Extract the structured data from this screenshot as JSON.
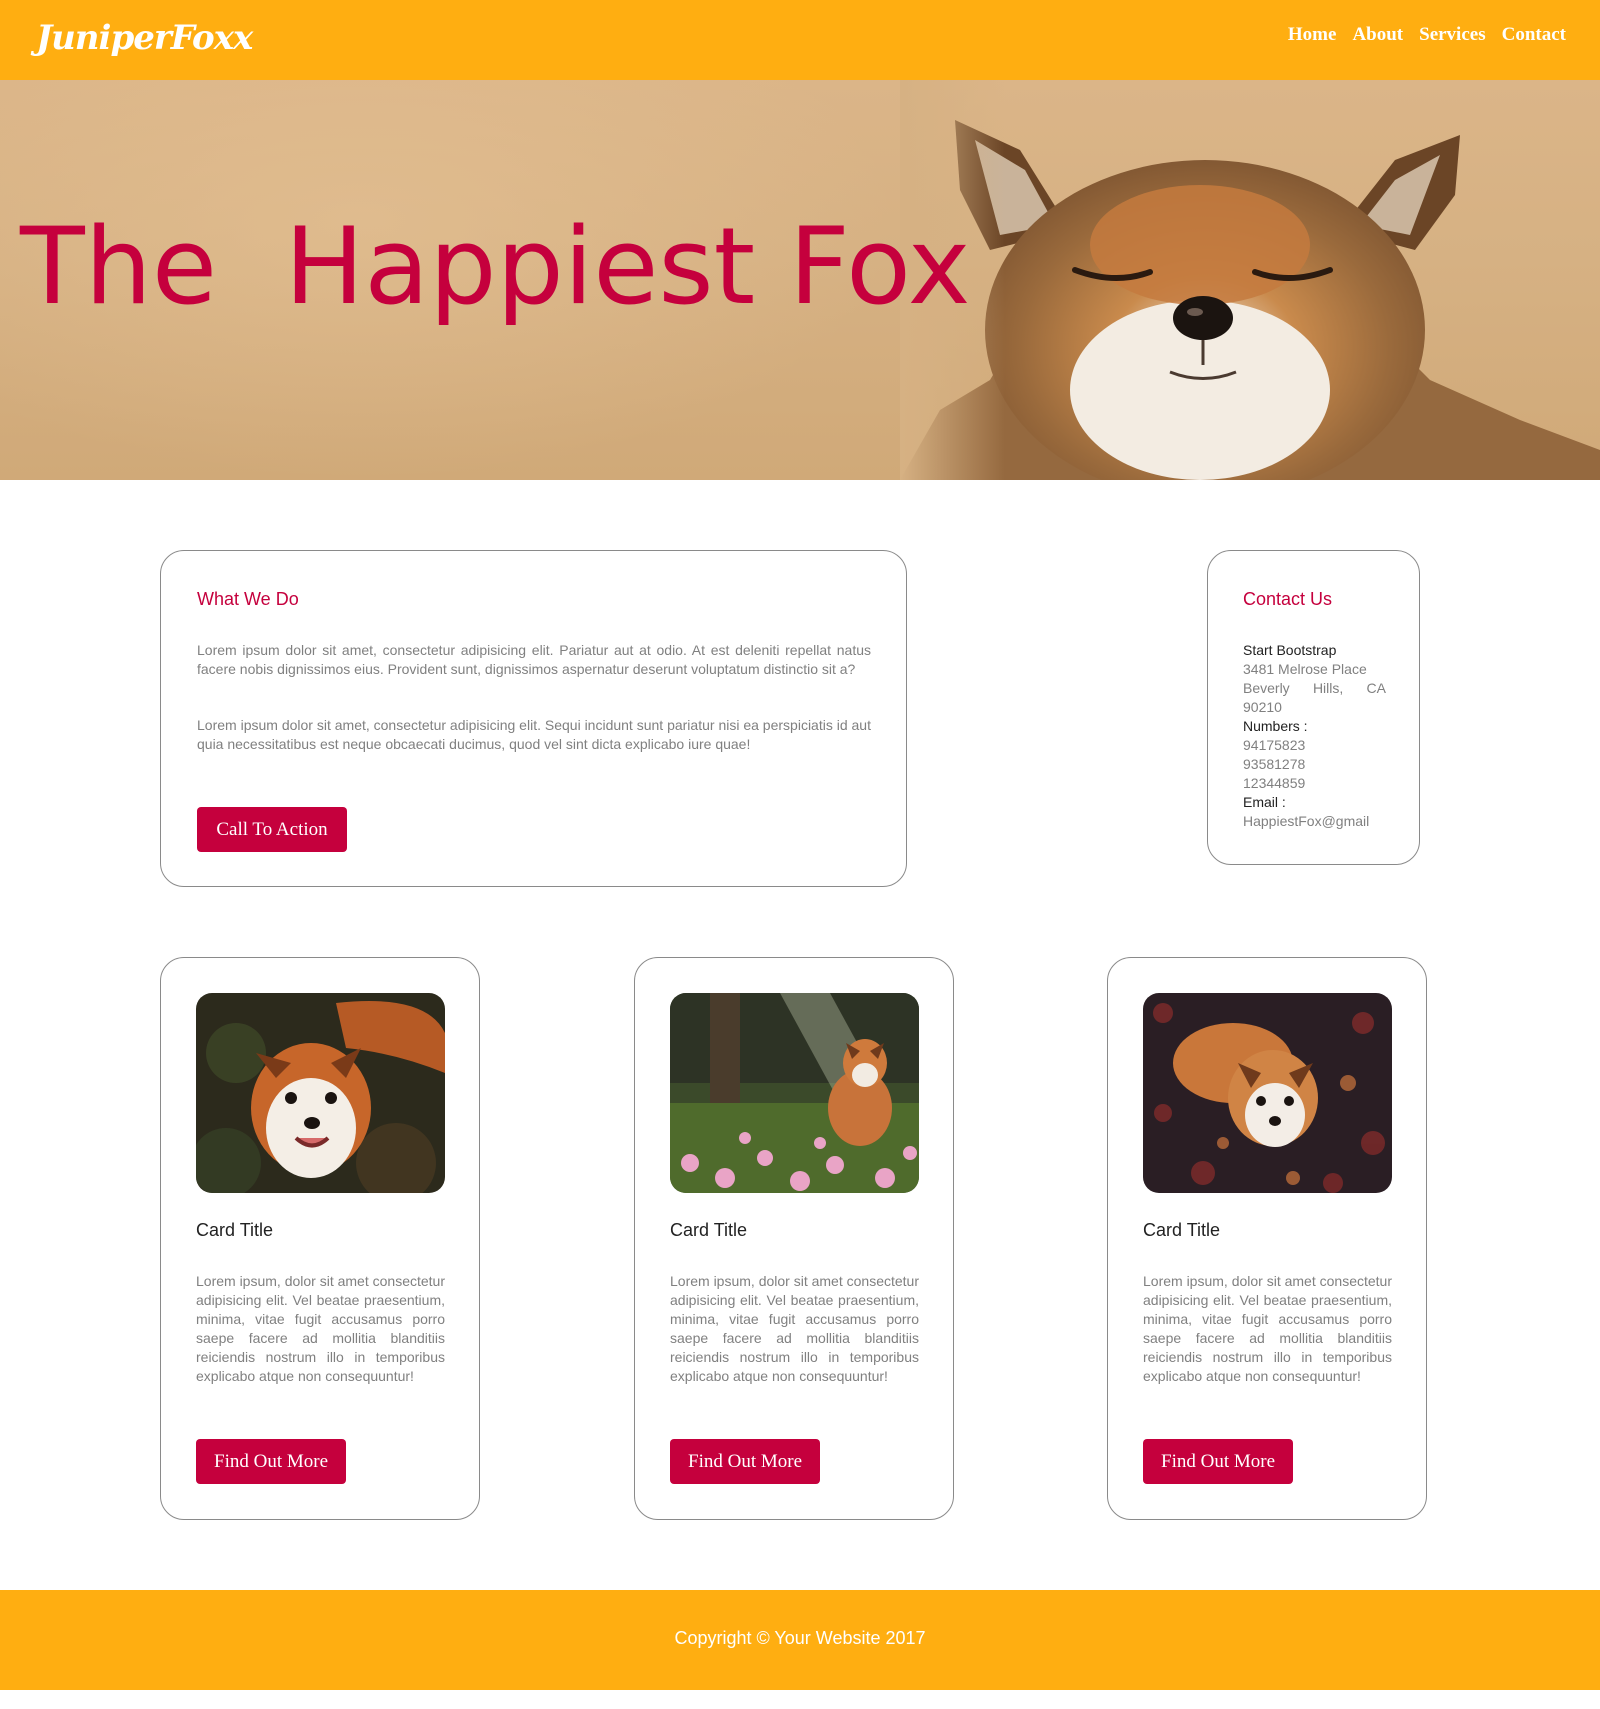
{
  "nav": {
    "brand": "JuniperFoxx",
    "links": [
      "Home",
      "About",
      "Services",
      "Contact"
    ]
  },
  "hero": {
    "title": "The  Happiest Fox",
    "image": "smiling-fox-photo"
  },
  "what_we_do": {
    "heading": "What We Do",
    "paragraph1": "Lorem ipsum dolor sit amet, consectetur adipisicing elit. Pariatur aut at odio. At est deleniti repellat natus facere nobis dignissimos eius. Provident sunt, dignissimos aspernatur deserunt voluptatum distinctio sit a?",
    "paragraph2": "Lorem ipsum dolor sit amet, consectetur adipisicing elit. Sequi incidunt sunt pariatur nisi ea perspiciatis id aut quia necessitatibus est neque obcaecati ducimus, quod vel sint dicta explicabo iure quae!",
    "button": "Call To Action"
  },
  "contact": {
    "heading": "Contact Us",
    "name": "Start Bootstrap",
    "address_line1": "3481 Melrose Place",
    "address_line2": "Beverly Hills, CA",
    "address_line3": "90210",
    "numbers_label": "Numbers :",
    "numbers": [
      "94175823",
      "93581278",
      "12344859"
    ],
    "email_label": "Email :",
    "email": "HappiestFox@gmail"
  },
  "cards": [
    {
      "title": "Card Title",
      "text": "Lorem ipsum, dolor sit amet consectetur adipisicing elit. Vel beatae praesentium, minima, vitae fugit accusamus porro saepe facere ad mollitia blanditiis reiciendis nostrum illo in temporibus explicabo atque non consequuntur!",
      "button": "Find Out More",
      "image": "fox-looking-up-photo"
    },
    {
      "title": "Card Title",
      "text": "Lorem ipsum, dolor sit amet consectetur adipisicing elit. Vel beatae praesentium, minima, vitae fugit accusamus porro saepe facere ad mollitia blanditiis reiciendis nostrum illo in temporibus explicabo atque non consequuntur!",
      "button": "Find Out More",
      "image": "fox-in-flowers-photo"
    },
    {
      "title": "Card Title",
      "text": "Lorem ipsum, dolor sit amet consectetur adipisicing elit. Vel beatae praesentium, minima, vitae fugit accusamus porro saepe facere ad mollitia blanditiis reiciendis nostrum illo in temporibus explicabo atque non consequuntur!",
      "button": "Find Out More",
      "image": "fox-in-leaves-photo"
    }
  ],
  "footer": {
    "text": "Copyright © Your Website 2017"
  },
  "colors": {
    "accent": "#ffae11",
    "brand_red": "#c5003d",
    "muted_text": "#808080"
  }
}
